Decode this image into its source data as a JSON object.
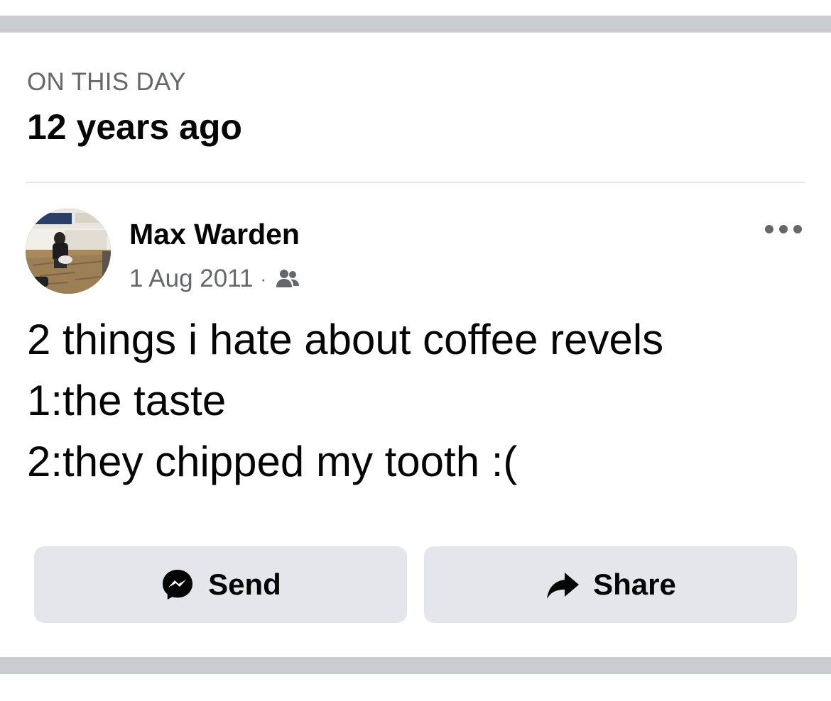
{
  "memory": {
    "label": "ON THIS DAY",
    "title": "12 years ago"
  },
  "post": {
    "author": "Max Warden",
    "date": "1 Aug 2011",
    "separator": "·",
    "audience_icon": "friends-icon",
    "more_icon": "more-options-icon",
    "body_lines": [
      "2 things i hate about coffee revels",
      "1:the taste",
      "2:they chipped my tooth :("
    ]
  },
  "actions": {
    "send": {
      "label": "Send",
      "icon": "messenger-icon"
    },
    "share": {
      "label": "Share",
      "icon": "share-arrow-icon"
    }
  },
  "colors": {
    "separator_band": "#c9ccd1",
    "secondary_text": "#65676b",
    "button_bg": "#e4e6eb",
    "primary_text": "#050505"
  }
}
